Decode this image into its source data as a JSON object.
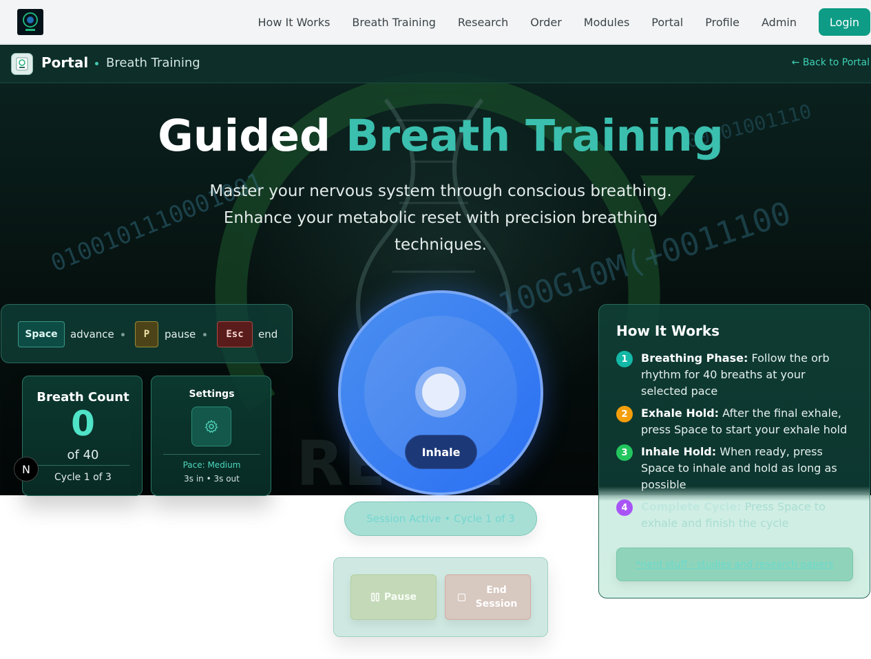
{
  "nav": {
    "links": [
      "How It Works",
      "Breath Training",
      "Research",
      "Order",
      "Modules",
      "Portal",
      "Profile",
      "Admin"
    ],
    "login_label": "Login"
  },
  "subheader": {
    "title": "Portal",
    "breadcrumb": "Breath Training",
    "back_link": "← Back to Portal"
  },
  "hero": {
    "title_white": "Guided",
    "title_accent": "Breath Training",
    "subtitle": "Master your nervous system through conscious breathing. Enhance your metabolic reset with precision breathing techniques."
  },
  "shortcuts": {
    "space_key": "Space",
    "space_label": "advance",
    "p_key": "P",
    "p_label": "pause",
    "esc_key": "Esc",
    "esc_label": "end"
  },
  "breath_count": {
    "title": "Breath Count",
    "value": "0",
    "total": "of 40",
    "cycle": "Cycle 1 of 3"
  },
  "settings": {
    "title": "Settings",
    "pace": "Pace: Medium",
    "rhythm": "3s in • 3s out"
  },
  "orb": {
    "phase": "Inhale"
  },
  "session": {
    "status": "Session Active • Cycle 1 of 3",
    "pause_label": "Pause",
    "end_label": "End Session"
  },
  "how_it_works": {
    "title": "How It Works",
    "steps": [
      {
        "num": "1",
        "bold": "Breathing Phase:",
        "text": "Follow the orb rhythm for 40 breaths at your selected pace",
        "color": "#14b8a6"
      },
      {
        "num": "2",
        "bold": "Exhale Hold:",
        "text": "After the final exhale, press Space to start your exhale hold",
        "color": "#f59e0b"
      },
      {
        "num": "3",
        "bold": "Inhale Hold:",
        "text": "When ready, press Space to inhale and hold as long as possible",
        "color": "#22c55e"
      },
      {
        "num": "4",
        "bold": "Complete Cycle:",
        "text": "Press Space to exhale and finish the cycle",
        "color": "#a855f7"
      }
    ],
    "nerd_link": "*nerd stuff - studies and research papers"
  },
  "misc": {
    "n_badge": "N"
  },
  "colors": {
    "accent": "#3bbfae",
    "login": "#0e9c86",
    "orb": "#2a6ff2"
  }
}
